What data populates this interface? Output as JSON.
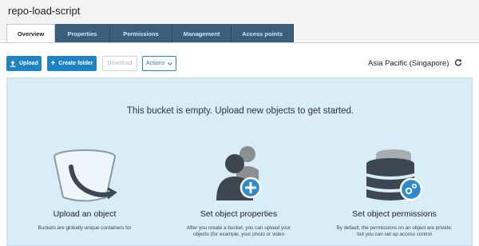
{
  "header": {
    "bucket_name": "repo-load-script",
    "tabs": [
      {
        "label": "Overview",
        "active": true
      },
      {
        "label": "Properties",
        "active": false
      },
      {
        "label": "Permissions",
        "active": false
      },
      {
        "label": "Management",
        "active": false
      },
      {
        "label": "Access points",
        "active": false
      }
    ]
  },
  "toolbar": {
    "upload_label": "Upload",
    "create_folder_label": "Create folder",
    "download_label": "Download",
    "actions_label": "Actions",
    "region": "Asia Pacific (Singapore)",
    "upload_icon": "upload-arrow-icon",
    "create_folder_icon": "plus-icon",
    "actions_icon": "chevron-down-icon",
    "refresh_icon": "refresh-icon"
  },
  "empty_state": {
    "message": "This bucket is empty. Upload new objects to get started.",
    "columns": [
      {
        "icon": "bucket-icon",
        "title": "Upload an object",
        "description": "Buckets are globally unique containers for"
      },
      {
        "icon": "user-plus-icon",
        "title": "Set object properties",
        "description": "After you create a bucket, you can upload your objects (for example, your photo or video"
      },
      {
        "icon": "database-gear-icon",
        "title": "Set object permissions",
        "description": "By default, the permissions on an object are private, but you can set up access control"
      }
    ]
  },
  "colors": {
    "accent": "#1f82c4",
    "tab_bg": "#3a5f7d",
    "panel_bg": "#d9edf7",
    "header_bg": "#f2f3f3"
  }
}
